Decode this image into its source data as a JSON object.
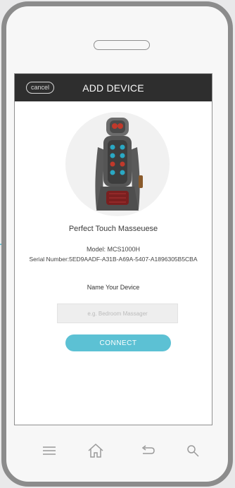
{
  "header": {
    "cancel_label": "cancel",
    "title": "ADD DEVICE"
  },
  "device": {
    "product_name": "Perfect Touch Masseuese",
    "model": "Model: MCS1000H",
    "serial": "Serial Number:5ED9AADF-A31B-A69A-5407-A1896305B5CBA",
    "image_icon": "massage-seat-image"
  },
  "form": {
    "name_label": "Name Your Device",
    "name_value": "",
    "name_placeholder": "e.g. Bedroom Massager",
    "connect_label": "CONNECT"
  },
  "nav": {
    "icons": [
      "menu-icon",
      "home-icon",
      "back-icon",
      "search-icon"
    ]
  },
  "colors": {
    "accent": "#5cc1d4",
    "header_bg": "#2e2e2e",
    "phone_frame": "#8c8c8c"
  }
}
